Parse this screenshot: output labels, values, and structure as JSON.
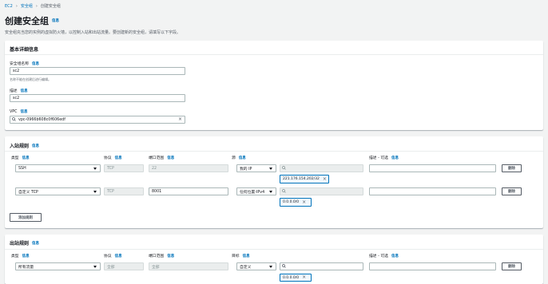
{
  "breadcrumb": {
    "root": "EC2",
    "parent": "安全组",
    "current": "创建安全组"
  },
  "page": {
    "title": "创建安全组",
    "info": "信息",
    "description": "安全组充当您的实例的虚拟防火墙，以控制入站和出站流量。要创建新的安全组，请填写以下字段。"
  },
  "basic": {
    "heading": "基本详细信息",
    "name_label": "安全组名称",
    "name_value": "sc2",
    "name_hint": "名称不能在创建后进行编辑。",
    "desc_label": "描述",
    "desc_value": "sc2",
    "vpc_label": "VPC",
    "vpc_value": "vpc-0966b608c0f606edf",
    "info": "信息"
  },
  "inbound": {
    "heading": "入站规则",
    "info": "信息",
    "col_type": "类型",
    "col_protocol": "协议",
    "col_port": "端口范围",
    "col_source": "源",
    "col_desc": "描述 - 可选",
    "rules": [
      {
        "type": "SSH",
        "protocol": "TCP",
        "port": "22",
        "source": "我的 IP",
        "search": "",
        "token": "221.176.154.202/32",
        "delete": "删除"
      },
      {
        "type": "自定义 TCP",
        "protocol": "TCP",
        "port": "8001",
        "source": "任何位置-IPv4",
        "search": "",
        "token": "0.0.0.0/0",
        "delete": "删除"
      }
    ],
    "add_rule": "添加规则"
  },
  "outbound": {
    "heading": "出站规则",
    "info": "信息",
    "col_type": "类型",
    "col_protocol": "协议",
    "col_port": "端口范围",
    "col_dest": "目标",
    "col_desc": "描述 - 可选",
    "rules": [
      {
        "type": "所有流量",
        "protocol": "全部",
        "port": "全部",
        "dest": "自定义",
        "token": "0.0.0.0/0",
        "delete": "删除"
      }
    ]
  },
  "icons": {
    "search": "search-icon",
    "close": "close-icon",
    "chevron": "chevron-down-icon",
    "breadcrumb_sep": "chevron-right-icon"
  },
  "colors": {
    "link": "#0073bb",
    "background": "#f2f3f3",
    "panel": "#ffffff"
  }
}
